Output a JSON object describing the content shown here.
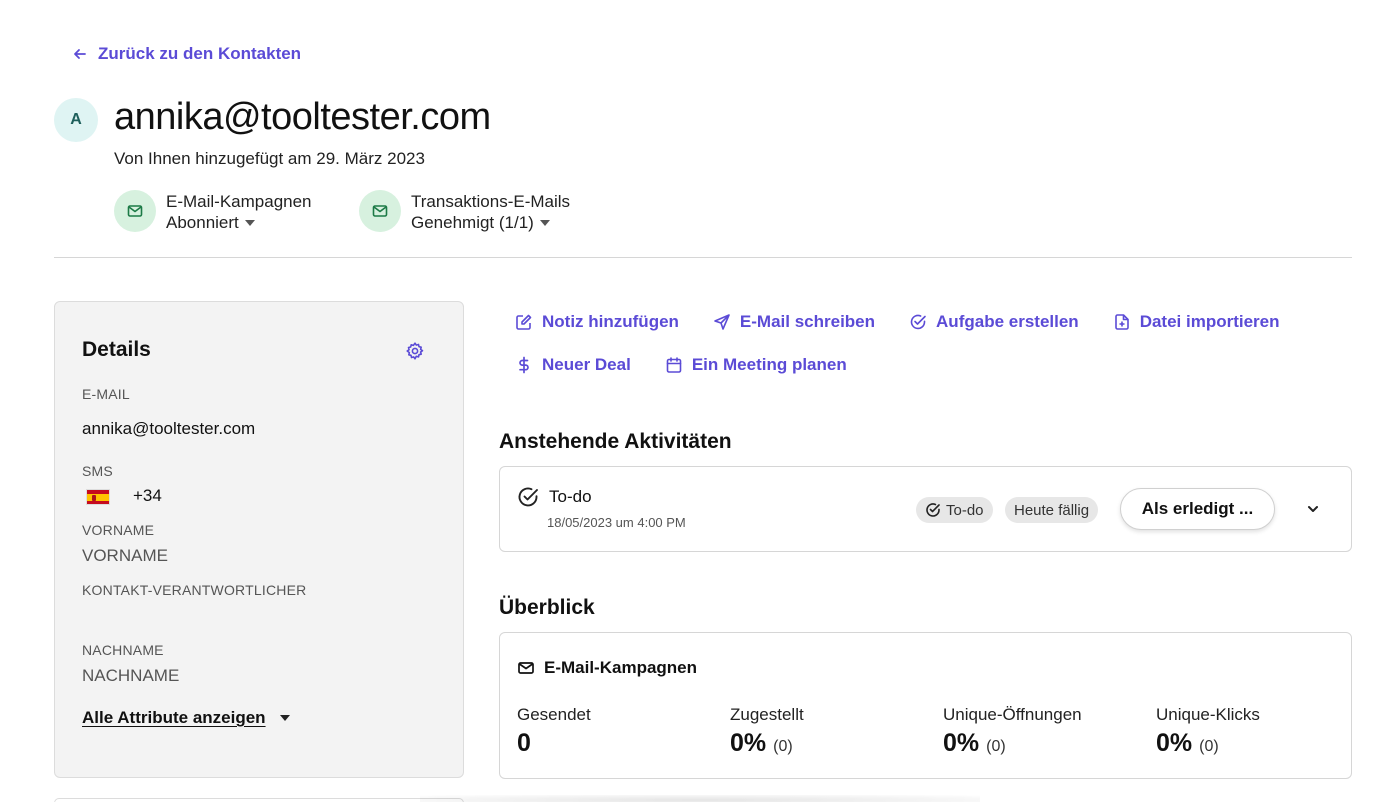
{
  "back_link": {
    "label": "Zurück zu den Kontakten",
    "icon": "arrow-left-icon"
  },
  "contact": {
    "avatar_initial": "A",
    "email_title": "annika@tooltester.com",
    "added_text": "Von Ihnen hinzugefügt am 29. März 2023"
  },
  "subscriptions": [
    {
      "label": "E-Mail-Kampagnen",
      "status": "Abonniert",
      "icon": "mail-icon"
    },
    {
      "label": "Transaktions-E-Mails",
      "status": "Genehmigt (1/1)",
      "icon": "mail-icon"
    }
  ],
  "details": {
    "title": "Details",
    "email_label": "E-MAIL",
    "email_value": "annika@tooltester.com",
    "sms_label": "SMS",
    "sms_prefix": "+34",
    "sms_flag": "spain-flag",
    "firstname_label": "VORNAME",
    "firstname_value": "VORNAME",
    "owner_label": "KONTAKT-VERANTWORTLICHER",
    "lastname_label": "NACHNAME",
    "lastname_value": "NACHNAME",
    "show_all": "Alle Attribute anzeigen"
  },
  "actions": [
    {
      "label": "Notiz hinzufügen",
      "icon": "edit-note-icon"
    },
    {
      "label": "E-Mail schreiben",
      "icon": "send-icon"
    },
    {
      "label": "Aufgabe erstellen",
      "icon": "check-circle-icon"
    },
    {
      "label": "Datei importieren",
      "icon": "file-import-icon"
    },
    {
      "label": "Neuer Deal",
      "icon": "dollar-icon"
    },
    {
      "label": "Ein Meeting planen",
      "icon": "calendar-icon"
    }
  ],
  "upcoming": {
    "title": "Anstehende Aktivitäten",
    "item": {
      "title": "To-do",
      "date": "18/05/2023 um 4:00 PM",
      "type_badge": "To-do",
      "due_badge": "Heute fällig",
      "done_button": "Als erledigt ..."
    }
  },
  "overview": {
    "title": "Überblick",
    "card_title": "E-Mail-Kampagnen",
    "stats": [
      {
        "label": "Gesendet",
        "value": "0",
        "count": ""
      },
      {
        "label": "Zugestellt",
        "value": "0%",
        "count": "(0)"
      },
      {
        "label": "Unique-Öffnungen",
        "value": "0%",
        "count": "(0)"
      },
      {
        "label": "Unique-Klicks",
        "value": "0%",
        "count": "(0)"
      }
    ]
  },
  "colors": {
    "accent": "#5b4bd6",
    "mail_icon_bg": "#d7f1df",
    "mail_icon_fg": "#1c7a46",
    "avatar_bg": "#dff4f3"
  }
}
